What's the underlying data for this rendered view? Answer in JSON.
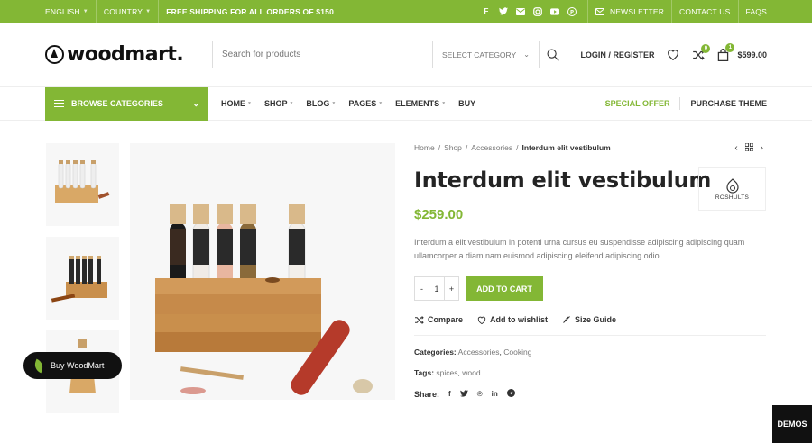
{
  "colors": {
    "accent": "#83b735",
    "dark": "#111111"
  },
  "topbar": {
    "language": "ENGLISH",
    "country": "COUNTRY",
    "promo": "FREE SHIPPING FOR ALL ORDERS OF $150",
    "social_icons": [
      "facebook-icon",
      "twitter-icon",
      "email-icon",
      "instagram-icon",
      "youtube-icon",
      "pinterest-icon"
    ],
    "newsletter": "NEWSLETTER",
    "contact": "CONTACT US",
    "faqs": "FAQS"
  },
  "header": {
    "logo_text": "woodmart.",
    "search_placeholder": "Search for products",
    "search_category": "SELECT CATEGORY",
    "login": "LOGIN / REGISTER",
    "compare_count": "0",
    "cart_count": "1",
    "cart_total": "$599.00"
  },
  "nav": {
    "browse": "BROWSE CATEGORIES",
    "items": [
      "HOME",
      "SHOP",
      "BLOG",
      "PAGES",
      "ELEMENTS",
      "BUY"
    ],
    "special_offer": "SPECIAL OFFER",
    "purchase": "PURCHASE THEME"
  },
  "product": {
    "breadcrumb": [
      "Home",
      "Shop",
      "Accessories",
      "Interdum elit vestibulum"
    ],
    "title": "Interdum elit vestibulum",
    "brand": "ROSHULTS",
    "price": "$259.00",
    "description": "Interdum a elit vestibulum in potenti urna cursus eu suspendisse adipiscing adipiscing quam ullamcorper a diam nam euismod adipiscing eleifend adipiscing odio.",
    "qty_minus": "-",
    "qty_value": "1",
    "qty_plus": "+",
    "add_to_cart": "ADD TO CART",
    "compare": "Compare",
    "wishlist": "Add to wishlist",
    "size_guide": "Size Guide",
    "categories_label": "Categories:",
    "categories": [
      "Accessories",
      "Cooking"
    ],
    "tags_label": "Tags:",
    "tags": [
      "spices",
      "wood"
    ],
    "share_label": "Share:"
  },
  "floating": {
    "demos": "DEMOS",
    "buy": "Buy WoodMart"
  }
}
